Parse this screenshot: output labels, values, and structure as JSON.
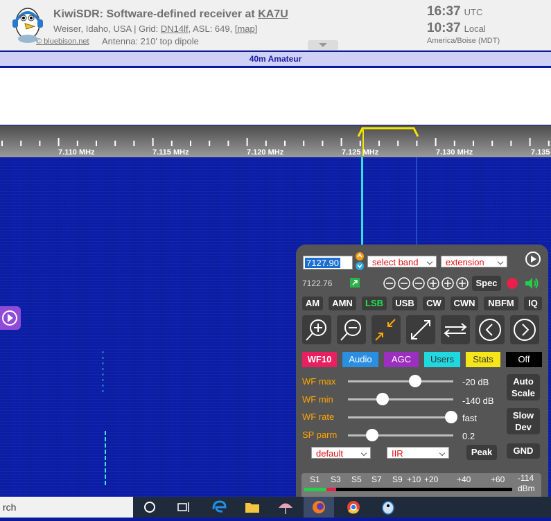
{
  "header": {
    "title_prefix": "KiwiSDR: Software-defined receiver at ",
    "title_callsign": "KA7U",
    "location_prefix": "Weiser, Idaho, USA | Grid: ",
    "grid": "DN14lf",
    "asl": ", ASL: 649, ",
    "map_link": "[map]",
    "credit": "© bluebison.net",
    "antenna": "Antenna: 210' top dipole",
    "utc_time": "16:37",
    "utc_label": "UTC",
    "local_time": "10:37",
    "local_label": "Local",
    "timezone": "America/Boise (MDT)"
  },
  "band_bar": {
    "label": "40m Amateur"
  },
  "scale": {
    "labels": [
      "7.110 MHz",
      "7.115 MHz",
      "7.120 MHz",
      "7.125 MHz",
      "7.130 MHz",
      "7.135"
    ],
    "passband_color": "#f5e600"
  },
  "panel": {
    "frequency": "7127.90",
    "band_select": "select band",
    "extension_select": "extension",
    "subfreq": "7122.76",
    "spec_button": "Spec",
    "modes": [
      "AM",
      "AMN",
      "LSB",
      "USB",
      "CW",
      "CWN",
      "NBFM",
      "IQ"
    ],
    "active_mode": "LSB",
    "tabs": [
      "WF10",
      "Audio",
      "AGC",
      "Users",
      "Stats",
      "Off"
    ],
    "sliders": [
      {
        "label": "WF max",
        "value": "-20 dB",
        "level": 0.64
      },
      {
        "label": "WF min",
        "value": "-140 dB",
        "level": 0.33
      },
      {
        "label": "WF rate",
        "value": "fast",
        "level": 0.98
      },
      {
        "label": "SP parm",
        "value": "0.2",
        "level": 0.23
      }
    ],
    "auto_scale": "Auto Scale",
    "slow_dev": "Slow Dev",
    "default_select": "default",
    "iir_select": "IIR",
    "peak_button": "Peak",
    "gnd_button": "GND",
    "smeter_labels": [
      "S1",
      "S3",
      "S5",
      "S7",
      "S9",
      "+10",
      "+20",
      "+40",
      "+60",
      "-114"
    ],
    "smeter_unit": "dBm"
  },
  "taskbar": {
    "search_text": "rch"
  },
  "colors": {
    "waterfall_bg": "#0b1ea8",
    "carrier": "#35e0d8",
    "accent_orange": "#ffa500"
  }
}
